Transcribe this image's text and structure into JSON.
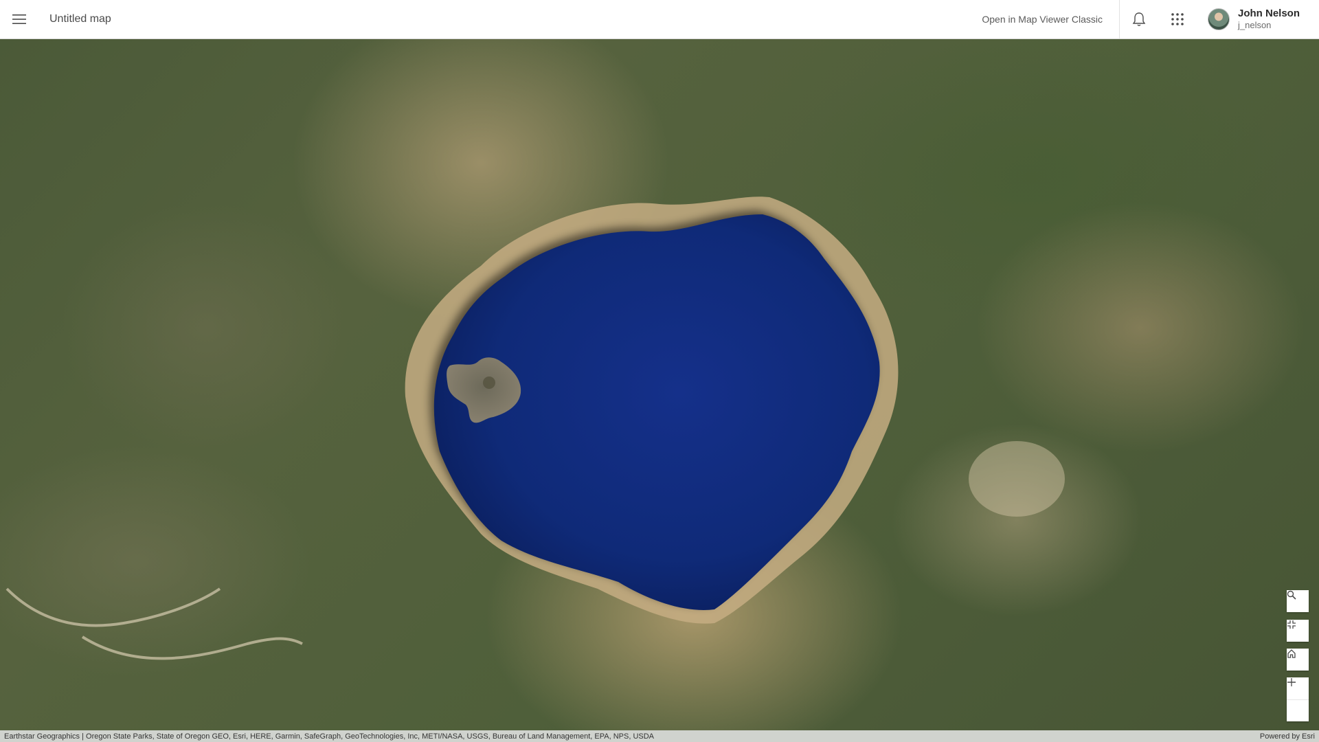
{
  "header": {
    "map_title": "Untitled map",
    "open_classic_label": "Open in Map Viewer Classic",
    "user": {
      "name": "John Nelson",
      "handle": "j_nelson"
    },
    "icons": [
      "menu-icon",
      "bell-icon",
      "app-launcher-icon"
    ]
  },
  "map": {
    "basemap": "imagery",
    "controls": {
      "search_icon": "search-icon",
      "fit_icon": "compress-icon",
      "home_icon": "home-icon",
      "zoom_in_icon": "plus-icon",
      "zoom_out_icon": "minus-icon"
    },
    "colors": {
      "lake": "#0f2a78",
      "forest": "#4b5a38",
      "rim": "#c6ad82"
    }
  },
  "attribution": {
    "text": "Earthstar Geographics | Oregon State Parks, State of Oregon GEO, Esri, HERE, Garmin, SafeGraph, GeoTechnologies, Inc, METI/NASA, USGS, Bureau of Land Management, EPA, NPS, USDA",
    "powered_by": "Powered by Esri"
  }
}
